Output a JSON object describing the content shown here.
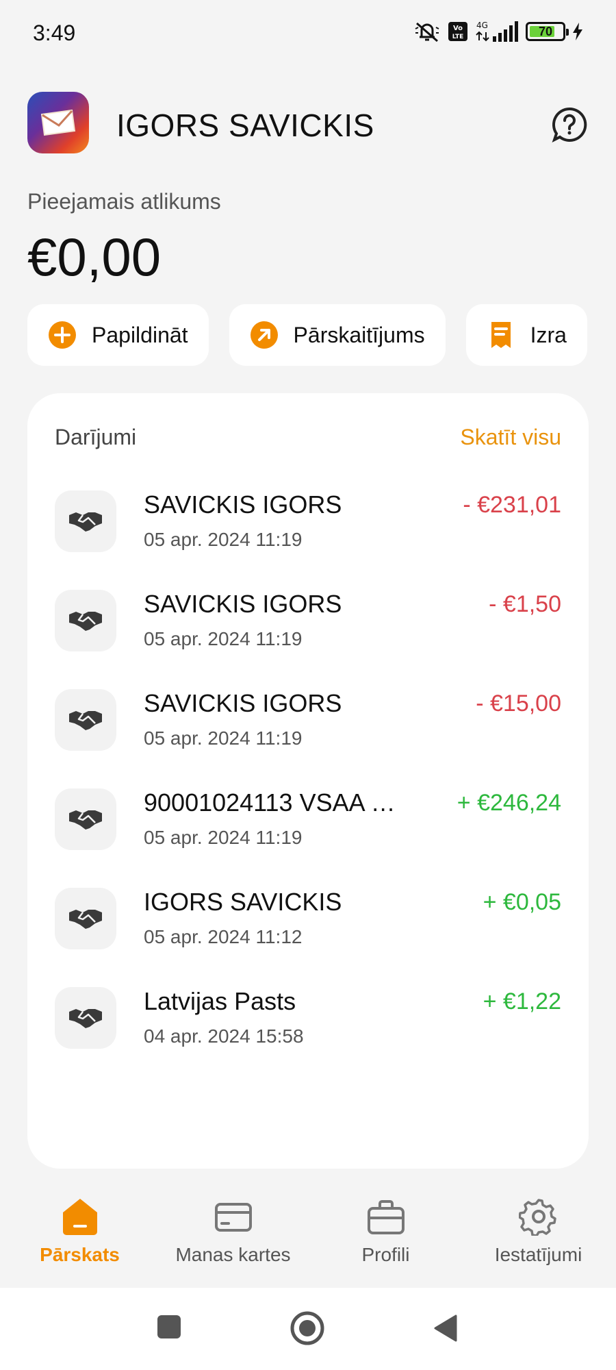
{
  "status_bar": {
    "time": "3:49",
    "battery": "70",
    "network": "4G"
  },
  "header": {
    "user_name": "IGORS SAVICKIS"
  },
  "balance": {
    "label": "Pieejamais atlikums",
    "amount": "€0,00"
  },
  "actions": [
    {
      "label": "Papildināt",
      "icon": "plus-circle-icon"
    },
    {
      "label": "Pārskaitījums",
      "icon": "arrow-up-right-icon"
    },
    {
      "label": "Izra",
      "icon": "receipt-icon"
    }
  ],
  "transactions": {
    "title": "Darījumi",
    "view_all": "Skatīt visu",
    "items": [
      {
        "name": "SAVICKIS IGORS",
        "date": "05 apr. 2024 11:19",
        "amount": "- €231,01",
        "type": "neg",
        "icon": "handshake-icon"
      },
      {
        "name": "SAVICKIS IGORS",
        "date": "05 apr. 2024 11:19",
        "amount": "- €1,50",
        "type": "neg",
        "icon": "handshake-icon"
      },
      {
        "name": "SAVICKIS IGORS",
        "date": "05 apr. 2024 11:19",
        "amount": "- €15,00",
        "type": "neg",
        "icon": "handshake-icon"
      },
      {
        "name": "90001024113  VSAA …",
        "date": "05 apr. 2024 11:19",
        "amount": "+ €246,24",
        "type": "pos",
        "icon": "handshake-icon"
      },
      {
        "name": "IGORS SAVICKIS",
        "date": "05 apr. 2024 11:12",
        "amount": "+ €0,05",
        "type": "pos",
        "icon": "handshake-icon"
      },
      {
        "name": "Latvijas Pasts",
        "date": "04 apr. 2024 15:58",
        "amount": "+ €1,22",
        "type": "pos",
        "icon": "handshake-icon"
      }
    ]
  },
  "bottom_nav": [
    {
      "label": "Pārskats",
      "icon": "home-icon",
      "active": true
    },
    {
      "label": "Manas kartes",
      "icon": "card-icon",
      "active": false
    },
    {
      "label": "Profili",
      "icon": "briefcase-icon",
      "active": false
    },
    {
      "label": "Iestatījumi",
      "icon": "gear-icon",
      "active": false
    }
  ],
  "colors": {
    "accent": "#f28c00",
    "negative": "#d9414a",
    "positive": "#2db83d",
    "background": "#f4f4f4"
  }
}
